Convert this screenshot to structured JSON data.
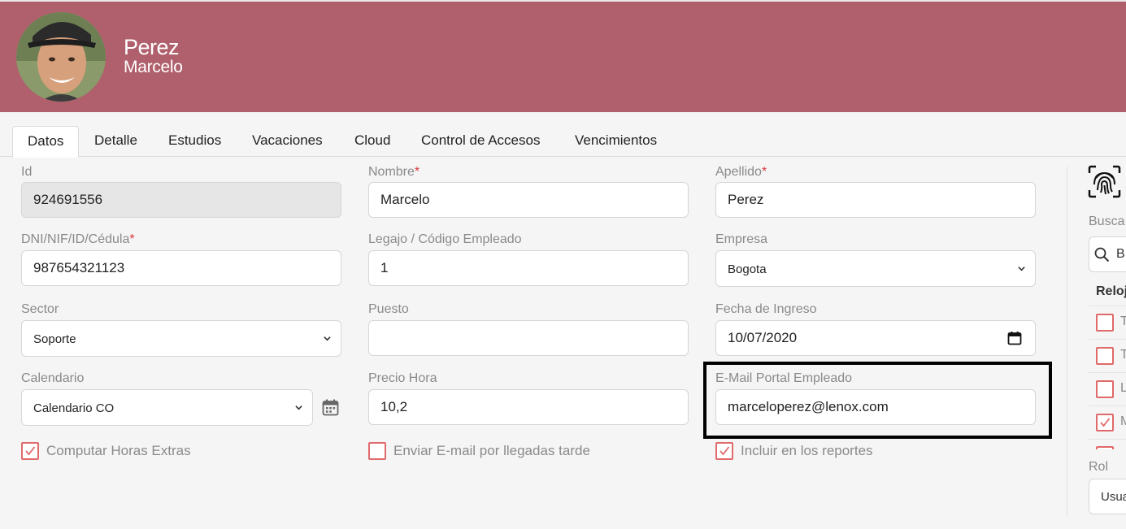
{
  "header": {
    "last_name": "Perez",
    "first_name": "Marcelo",
    "bg_color": "#b0606c"
  },
  "tabs": [
    {
      "label": "Datos",
      "active": true
    },
    {
      "label": "Detalle"
    },
    {
      "label": "Estudios"
    },
    {
      "label": "Vacaciones"
    },
    {
      "label": "Cloud"
    },
    {
      "label": "Control de Accesos"
    },
    {
      "label": "Vencimientos"
    }
  ],
  "form": {
    "id": {
      "label": "Id",
      "value": "924691556"
    },
    "nombre": {
      "label": "Nombre",
      "required": "*",
      "value": "Marcelo"
    },
    "apellido": {
      "label": "Apellido",
      "required": "*",
      "value": "Perez"
    },
    "dni": {
      "label": "DNI/NIF/ID/Cédula",
      "required": "*",
      "value": "987654321123"
    },
    "legajo": {
      "label": "Legajo / Código Empleado",
      "value": "1"
    },
    "empresa": {
      "label": "Empresa",
      "value": "Bogota"
    },
    "sector": {
      "label": "Sector",
      "value": "Soporte"
    },
    "puesto": {
      "label": "Puesto",
      "value": ""
    },
    "fecha_ingreso": {
      "label": "Fecha de Ingreso",
      "value": "10/07/2020"
    },
    "calendario": {
      "label": "Calendario",
      "value": "Calendario CO"
    },
    "precio_hora": {
      "label": "Precio Hora",
      "value": "10,2"
    },
    "email": {
      "label": "E-Mail Portal Empleado",
      "value": "marceloperez@lenox.com"
    },
    "checks": {
      "horas_extras": {
        "label": "Computar Horas Extras",
        "checked": true
      },
      "email_tarde": {
        "label": "Enviar E-mail por llegadas tarde",
        "checked": false
      },
      "reportes": {
        "label": "Incluir en los reportes",
        "checked": true
      }
    }
  },
  "side": {
    "search_label": "Busca",
    "search_placeholder": "B",
    "relojes_head": "Reloj",
    "rows": [
      {
        "text": "T",
        "checked": false
      },
      {
        "text": "T",
        "checked": false
      },
      {
        "text": "L",
        "checked": false
      },
      {
        "text": "M",
        "checked": true
      }
    ],
    "rol_label": "Rol",
    "rol_value": "Usua"
  },
  "colors": {
    "accent_check": "#e06a6a",
    "required": "#d9363e"
  }
}
